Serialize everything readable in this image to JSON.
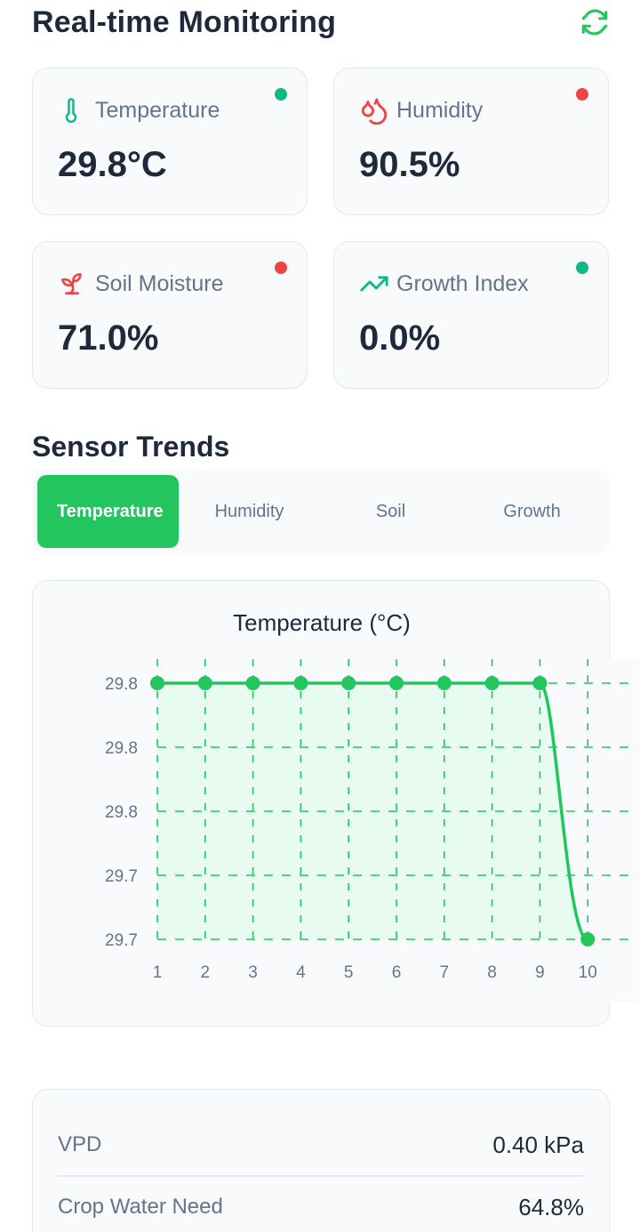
{
  "header": {
    "title": "Real-time Monitoring",
    "refresh_icon": "refresh-icon"
  },
  "colors": {
    "accent": "#22c55e",
    "status_ok": "#10b981",
    "status_alert": "#ef4444",
    "text_dark": "#1e293b",
    "text_muted": "#64748b"
  },
  "cards": [
    {
      "label": "Temperature",
      "value": "29.8°C",
      "icon": "thermometer-icon",
      "status": "ok"
    },
    {
      "label": "Humidity",
      "value": "90.5%",
      "icon": "droplets-icon",
      "status": "alert"
    },
    {
      "label": "Soil Moisture",
      "value": "71.0%",
      "icon": "sprout-icon",
      "status": "alert"
    },
    {
      "label": "Growth Index",
      "value": "0.0%",
      "icon": "trending-up-icon",
      "status": "ok"
    }
  ],
  "trends": {
    "title": "Sensor Trends",
    "tabs": [
      {
        "label": "Temperature",
        "active": true
      },
      {
        "label": "Humidity",
        "active": false
      },
      {
        "label": "Soil",
        "active": false
      },
      {
        "label": "Growth",
        "active": false
      }
    ]
  },
  "chart_data": {
    "type": "area",
    "title": "Temperature (°C)",
    "x": [
      1,
      2,
      3,
      4,
      5,
      6,
      7,
      8,
      9,
      10
    ],
    "series": [
      {
        "values": [
          29.8,
          29.8,
          29.8,
          29.8,
          29.8,
          29.8,
          29.8,
          29.8,
          29.8,
          29.7
        ]
      }
    ],
    "yticks": [
      "29.8",
      "29.8",
      "29.8",
      "29.7",
      "29.7"
    ],
    "ylim": [
      29.7,
      29.8
    ],
    "grid": true,
    "line_color": "#22c55e",
    "fill_color": "#dcfce7"
  },
  "stats": [
    {
      "label": "VPD",
      "value": "0.40 kPa"
    },
    {
      "label": "Crop Water Need",
      "value": "64.8%"
    }
  ]
}
